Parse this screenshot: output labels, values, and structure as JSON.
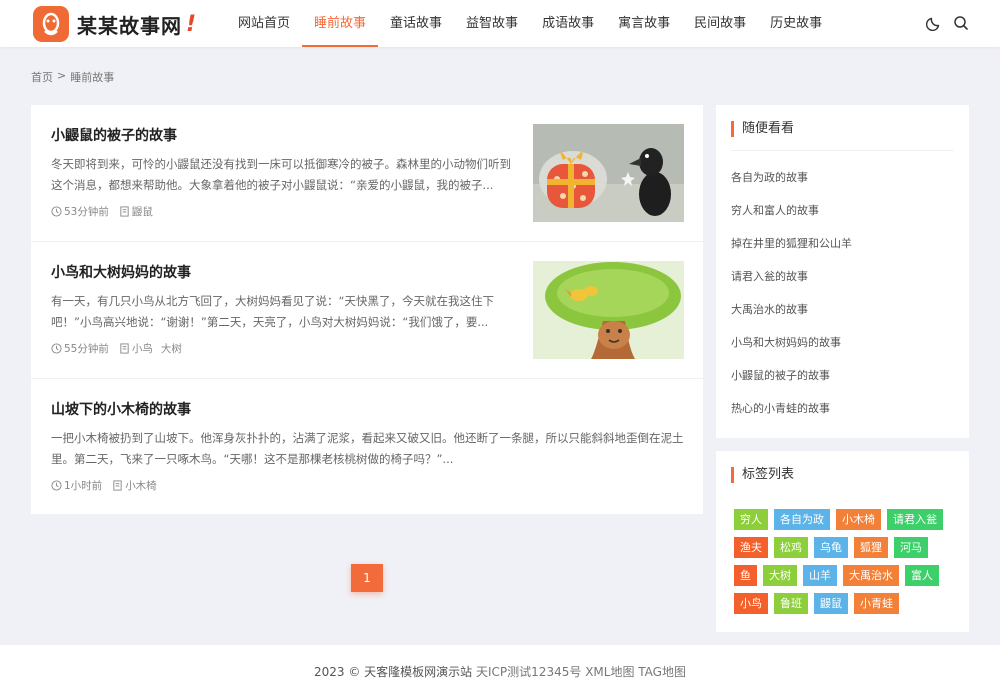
{
  "site": {
    "name": "某某故事网",
    "exclaim": "!"
  },
  "nav": [
    "网站首页",
    "睡前故事",
    "童话故事",
    "益智故事",
    "成语故事",
    "寓言故事",
    "民间故事",
    "历史故事"
  ],
  "nav_active": 1,
  "icons": {
    "theme": "moon-icon",
    "search": "search-icon"
  },
  "breadcrumb": {
    "home": "首页",
    "sep": ">",
    "current": "睡前故事"
  },
  "articles": [
    {
      "title": "小鼹鼠的被子的故事",
      "desc": "冬天即将到来，可怜的小鼹鼠还没有找到一床可以抵御寒冷的被子。森林里的小动物们听到这个消息，都想来帮助他。大象拿着他的被子对小鼹鼠说：“亲爱的小鼹鼠，我的被子...",
      "time": "53分钟前",
      "tags": [
        "鼹鼠"
      ]
    },
    {
      "title": "小鸟和大树妈妈的故事",
      "desc": "有一天，有几只小鸟从北方飞回了，大树妈妈看见了说：“天快黑了，今天就在我这住下吧！”小鸟高兴地说：“谢谢！”第二天，天亮了，小鸟对大树妈妈说：“我们饿了，要...",
      "time": "55分钟前",
      "tags": [
        "小鸟",
        "大树"
      ]
    },
    {
      "title": "山坡下的小木椅的故事",
      "desc": "一把小木椅被扔到了山坡下。他浑身灰扑扑的，沾满了泥浆，看起来又破又旧。他还断了一条腿，所以只能斜斜地歪倒在泥土里。第二天，飞来了一只啄木鸟。“天哪！这不是那棵老核桃树做的椅子吗？”...",
      "time": "1小时前",
      "tags": [
        "小木椅"
      ]
    }
  ],
  "pagination": {
    "current": "1"
  },
  "sidebar": {
    "random_title": "随便看看",
    "random": [
      "各自为政的故事",
      "穷人和富人的故事",
      "掉在井里的狐狸和公山羊",
      "请君入瓮的故事",
      "大禹治水的故事",
      "小鸟和大树妈妈的故事",
      "小鼹鼠的被子的故事",
      "热心的小青蛙的故事"
    ],
    "tags_title": "标签列表",
    "tags": [
      {
        "label": "穷人",
        "color": "#8ccf3a"
      },
      {
        "label": "各自为政",
        "color": "#5bb3e8"
      },
      {
        "label": "小木椅",
        "color": "#f28038"
      },
      {
        "label": "请君入瓮",
        "color": "#3dcf6a"
      },
      {
        "label": "渔夫",
        "color": "#f4602c"
      },
      {
        "label": "松鸡",
        "color": "#8ccf3a"
      },
      {
        "label": "乌龟",
        "color": "#5bb3e8"
      },
      {
        "label": "狐狸",
        "color": "#f28038"
      },
      {
        "label": "河马",
        "color": "#3dcf6a"
      },
      {
        "label": "鱼",
        "color": "#f4602c"
      },
      {
        "label": "大树",
        "color": "#8ccf3a"
      },
      {
        "label": "山羊",
        "color": "#5bb3e8"
      },
      {
        "label": "大禹治水",
        "color": "#f28038"
      },
      {
        "label": "富人",
        "color": "#3dcf6a"
      },
      {
        "label": "小鸟",
        "color": "#f4602c"
      },
      {
        "label": "鲁班",
        "color": "#8ccf3a"
      },
      {
        "label": "鼹鼠",
        "color": "#5bb3e8"
      },
      {
        "label": "小青蛙",
        "color": "#f28038"
      }
    ]
  },
  "footer": {
    "copyright": "2023 © 天客隆模板网演示站",
    "icp": "天ICP测试12345号",
    "xml": "XML地图",
    "tag": "TAG地图"
  }
}
